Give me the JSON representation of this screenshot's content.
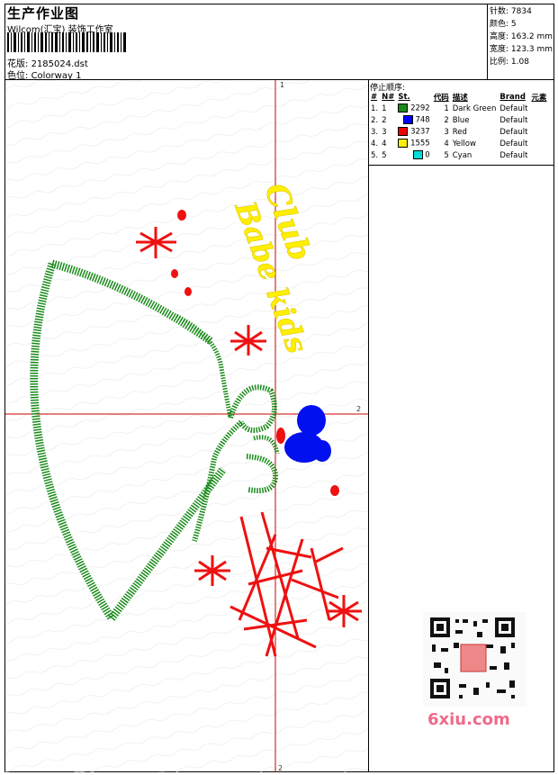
{
  "header": {
    "title": "生产作业图",
    "subtitle": "Wilcom(汇宝) 装饰工作室",
    "pattern_label": "花版:",
    "pattern_value": "2185024.dst",
    "color_label": "色位:",
    "color_value": "Colorway 1"
  },
  "info": {
    "stitches": "针数: 7834",
    "colors": "颜色: 5",
    "height": "高度: 163.2 mm",
    "width": "宽度: 123.3 mm",
    "scale": "比例: 1.08"
  },
  "stop_sequence": {
    "title": "停止顺序:",
    "headers": [
      "#",
      "N#",
      "St.",
      "代码",
      "描述",
      "Brand",
      "元素"
    ],
    "rows": [
      {
        "num": "1.",
        "n": "1",
        "color": "#1a8a1a",
        "st": "2292",
        "code": "1",
        "desc": "Dark Green",
        "brand": "Default"
      },
      {
        "num": "2.",
        "n": "2",
        "color": "#0000ff",
        "st": "748",
        "code": "2",
        "desc": "Blue",
        "brand": "Default"
      },
      {
        "num": "3.",
        "n": "3",
        "color": "#ee0000",
        "st": "3237",
        "code": "3",
        "desc": "Red",
        "brand": "Default"
      },
      {
        "num": "4.",
        "n": "4",
        "color": "#ffee00",
        "st": "1555",
        "code": "4",
        "desc": "Yellow",
        "brand": "Default"
      },
      {
        "num": "5.",
        "n": "5",
        "color": "#00dddd",
        "st": "0",
        "code": "5",
        "desc": "Cyan",
        "brand": "Default"
      }
    ]
  },
  "axis": {
    "top": "1",
    "right": "2",
    "bottom": "2"
  },
  "design_text": {
    "line1": "Club",
    "line2": "Babe kids"
  },
  "watermark": "6xiu.com"
}
